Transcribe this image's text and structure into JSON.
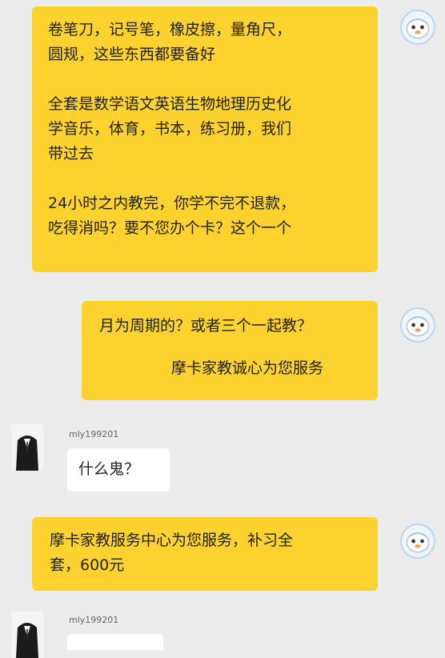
{
  "messages": [
    {
      "side": "outgoing",
      "paragraphs": [
        [
          "卷笔刀，记号笔，橡皮擦，量角尺，",
          "圆规，这些东西都要备好"
        ],
        [
          "全套是数学语文英语生物地理历史化",
          "学音乐，体育，书本，练习册，我们",
          "带过去"
        ],
        [
          "24小时之内教完，你学不完不退款，",
          "吃得消吗？要不您办个卡？这个一个"
        ]
      ]
    },
    {
      "side": "outgoing",
      "paragraphs": [
        [
          "月为周期的？或者三个一起教？"
        ],
        [
          "摩卡家教诚心为您服务"
        ]
      ]
    },
    {
      "side": "incoming",
      "username": "mly199201",
      "text": "什么鬼？"
    },
    {
      "side": "outgoing",
      "paragraphs": [
        [
          "摩卡家教服务中心为您服务，补习全",
          "套，600元"
        ]
      ]
    },
    {
      "side": "incoming",
      "username": "mly199201",
      "text": ""
    }
  ],
  "colors": {
    "background": "#ececec",
    "outgoing_bubble": "#fbd22e",
    "incoming_bubble": "#ffffff"
  },
  "icons": {
    "robot_avatar": "robot-avatar-icon",
    "user_avatar": "suit-avatar-icon"
  }
}
